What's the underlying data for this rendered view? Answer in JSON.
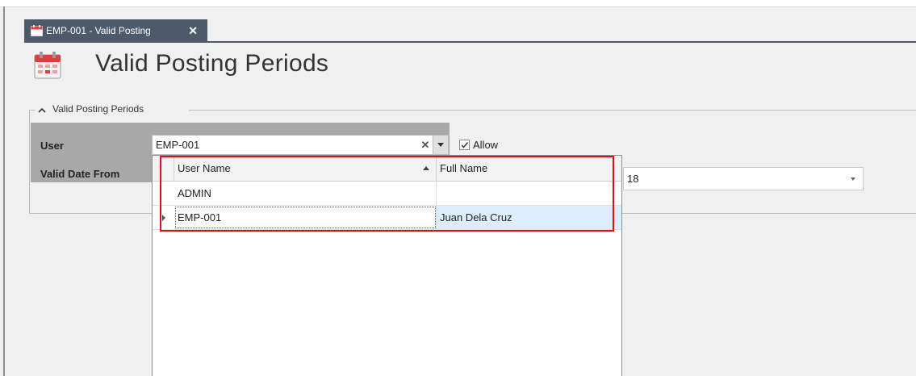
{
  "tab": {
    "label": "EMP-001 - Valid Posting",
    "close_glyph": "✕"
  },
  "page": {
    "title": "Valid Posting Periods"
  },
  "group": {
    "header": "Valid Posting Periods"
  },
  "form": {
    "user_label": "User",
    "user_value": "EMP-001",
    "clear_glyph": "✕",
    "allow_label": "Allow",
    "date_label": "Valid Date From",
    "date_value_fragment": "18"
  },
  "lookup": {
    "columns": [
      "User Name",
      "Full Name"
    ],
    "rows": [
      {
        "user_name": "ADMIN",
        "full_name": ""
      },
      {
        "user_name": "EMP-001",
        "full_name": "Juan Dela Cruz"
      }
    ]
  },
  "colors": {
    "tab_bg": "#4c5a6b",
    "highlight": "#e01010",
    "selected_row": "#ddeeff"
  }
}
